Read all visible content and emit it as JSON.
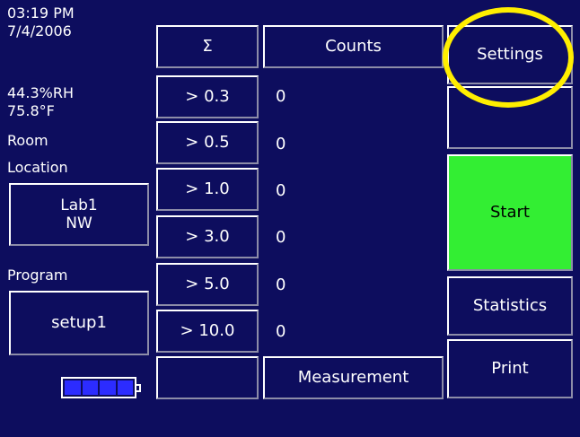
{
  "status": {
    "time": "03:19 PM",
    "date": "7/4/2006",
    "humidity": "44.3%RH",
    "temperature": "75.8°F",
    "room_label": "Room",
    "location_label": "Location",
    "location_line1": "Lab1",
    "location_line2": "NW",
    "program_label": "Program",
    "program_value": "setup1",
    "battery_cells": 4
  },
  "table": {
    "sum_header": "Σ",
    "counts_header": "Counts",
    "rows": [
      {
        "size": "> 0.3",
        "count": "0"
      },
      {
        "size": "> 0.5",
        "count": "0"
      },
      {
        "size": "> 1.0",
        "count": "0"
      },
      {
        "size": "> 3.0",
        "count": "0"
      },
      {
        "size": "> 5.0",
        "count": "0"
      },
      {
        "size": "> 10.0",
        "count": "0"
      }
    ],
    "footer_empty": "",
    "measurement_label": "Measurement"
  },
  "buttons": {
    "settings": "Settings",
    "blank": "",
    "start": "Start",
    "statistics": "Statistics",
    "print": "Print"
  },
  "colors": {
    "background": "#0d0d5e",
    "start_green": "#33ee33",
    "highlight_circle": "#ffee00",
    "battery_fill": "#2c2cff"
  }
}
